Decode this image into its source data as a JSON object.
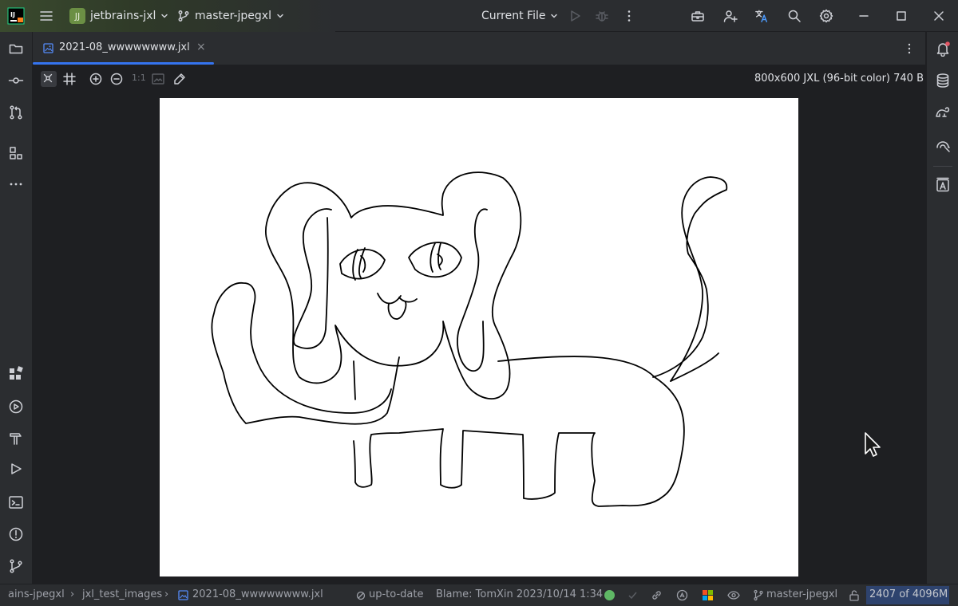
{
  "titlebar": {
    "app_icon": "jetbrains-icon",
    "menu_icon": "hamburger-menu-icon",
    "project_badge": "JJ",
    "project_name": "jetbrains-jxl",
    "branch_name": "master-jpegxl",
    "run_config": "Current File",
    "icons": [
      "run-icon",
      "debug-icon",
      "more-vert-icon",
      "toolbox-icon",
      "add-user-icon",
      "translate-icon",
      "search-icon",
      "settings-icon",
      "minimize-icon",
      "maximize-icon",
      "close-icon"
    ]
  },
  "left_toolwindows": [
    "project-icon",
    "commit-icon",
    "pull-requests-icon",
    "structure-icon",
    "more-horiz-icon",
    "plugins-icon",
    "services-icon",
    "build-icon",
    "run-tool-icon",
    "terminal-icon",
    "problems-icon",
    "git-icon"
  ],
  "right_toolwindows": [
    "notifications-icon",
    "database-icon",
    "gradle-icon",
    "ai-assistant-icon",
    "translate-panel-icon"
  ],
  "tab": {
    "file_name": "2021-08_wwwwwwww.jxl",
    "close": "×"
  },
  "image_toolbar": {
    "zoom_label": "1:1",
    "image_info": "800x600 JXL (96-bit color) 740 B",
    "icons": [
      "grid-toggle-icon",
      "chessboard-icon",
      "zoom-in-icon",
      "zoom-out-icon",
      "actual-size-icon",
      "fit-image-icon",
      "color-picker-icon"
    ]
  },
  "statusbar": {
    "breadcrumbs": [
      "ains-jpegxl",
      "jxl_test_images",
      "2021-08_wwwwwwww.jxl"
    ],
    "vcs_status": "up-to-date",
    "blame": "Blame: TomXin 2023/10/14 1:34",
    "branch": "master-jpegxl",
    "memory": "2407 of 4096M",
    "colors": {
      "green_dot": "#5fb865",
      "accent": "#3574f0",
      "memory_bg": "#2e436e"
    }
  }
}
